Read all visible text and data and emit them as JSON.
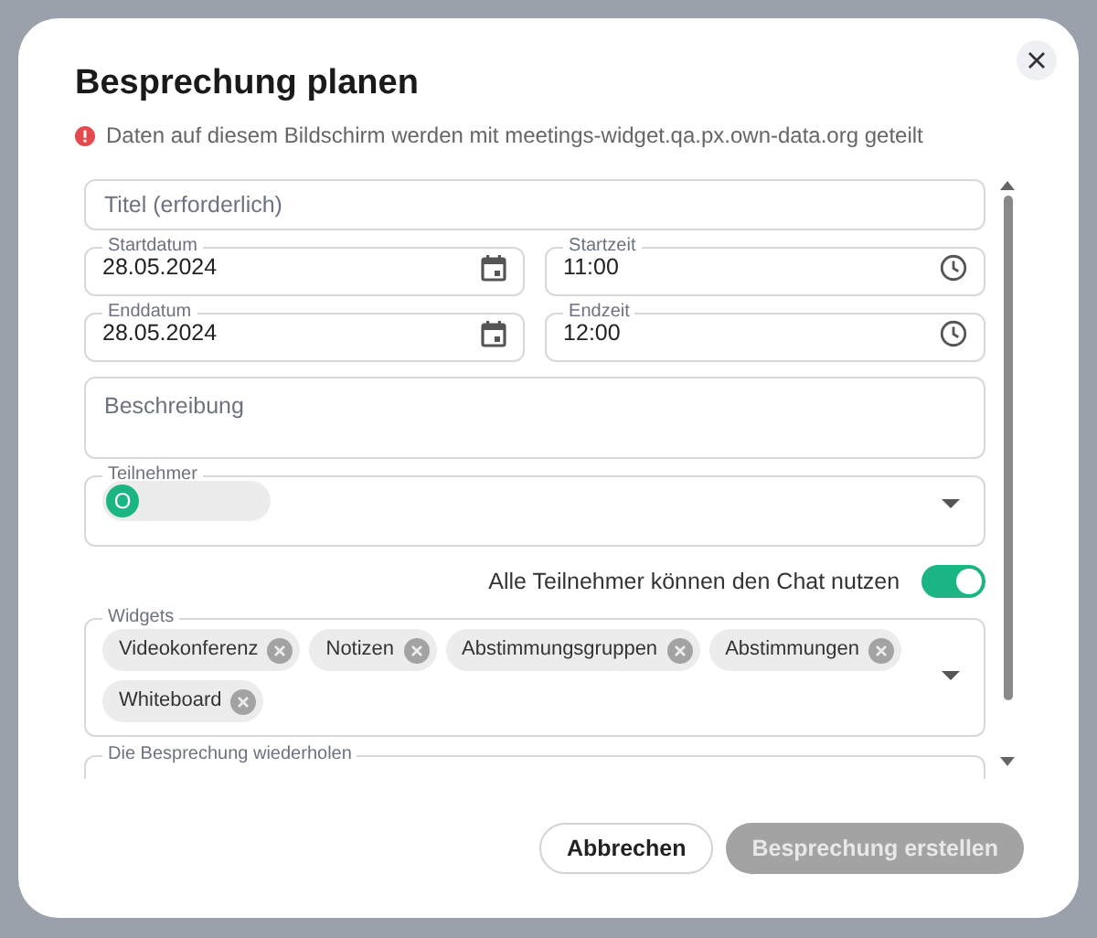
{
  "dialog": {
    "title": "Besprechung planen",
    "notice": "Daten auf diesem Bildschirm werden mit meetings-widget.qa.px.own-data.org geteilt"
  },
  "form": {
    "title_field": {
      "placeholder": "Titel (erforderlich)"
    },
    "start": {
      "date": {
        "label": "Startdatum",
        "value": "28.05.2024"
      },
      "time": {
        "label": "Startzeit",
        "value": "11:00"
      }
    },
    "end": {
      "date": {
        "label": "Enddatum",
        "value": "28.05.2024"
      },
      "time": {
        "label": "Endzeit",
        "value": "12:00"
      }
    },
    "description": {
      "placeholder": "Beschreibung"
    },
    "participants": {
      "label": "Teilnehmer",
      "chips": [
        {
          "initial": "O"
        }
      ]
    },
    "chat_toggle": {
      "label": "Alle Teilnehmer können den Chat nutzen",
      "on": true
    },
    "widgets": {
      "label": "Widgets",
      "chips": [
        {
          "label": "Videokonferenz"
        },
        {
          "label": "Notizen"
        },
        {
          "label": "Abstimmungsgruppen"
        },
        {
          "label": "Abstimmungen"
        },
        {
          "label": "Whiteboard"
        }
      ]
    },
    "repeat": {
      "label": "Die Besprechung wiederholen"
    }
  },
  "buttons": [
    {
      "label": "Abbrechen",
      "kind": "secondary",
      "disabled": false
    },
    {
      "label": "Besprechung erstellen",
      "kind": "primary",
      "disabled": true
    }
  ]
}
